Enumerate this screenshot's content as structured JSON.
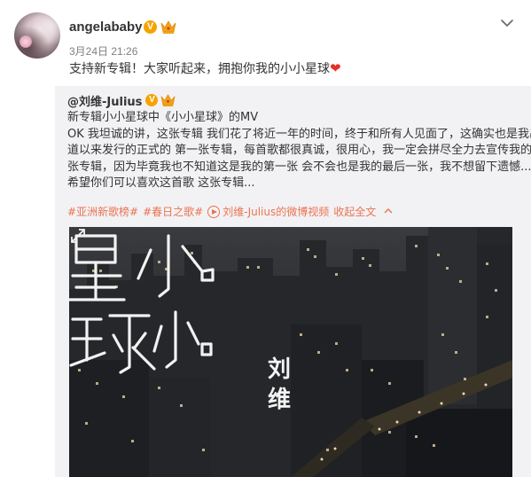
{
  "post": {
    "username": "angelababy",
    "verified_badge": "V",
    "timestamp": "3月24日 21:26",
    "text": "支持新专辑！大家听起来，拥抱你我的小小星球",
    "heart_icon": "❤",
    "menu_icon": "chevron-down-icon"
  },
  "repost": {
    "author": "@刘维-Julius",
    "verified_badge": "V",
    "lines": [
      "新专辑小小星球中《小小星球》的MV",
      "OK 我坦诚的讲，这张专辑 我们花了将近一年的时间，终于和所有人见面了，这确实也是我出",
      "道以来发行的正式的 第一张专辑，每首歌都很真诚，很用心，我一定会拼尽全力去宣传我的这",
      "张专辑，因为毕竟我也不知道这是我的第一张 会不会也是我的最后一张，我不想留下遗憾...",
      "希望你们可以喜欢这首歌 这张专辑..."
    ],
    "tags": [
      "#亚洲新歌榜#",
      "#春日之歌#"
    ],
    "video_link": "刘维-Julius的微博视频",
    "collapse_label": "收起全文",
    "link_color": "#eb7350"
  },
  "video": {
    "title_art": "小小星球",
    "artist_text": "刘维"
  },
  "colors": {
    "verified": "#f5a300",
    "heart": "#e1332a",
    "repost_bg": "#f2f2f5"
  }
}
